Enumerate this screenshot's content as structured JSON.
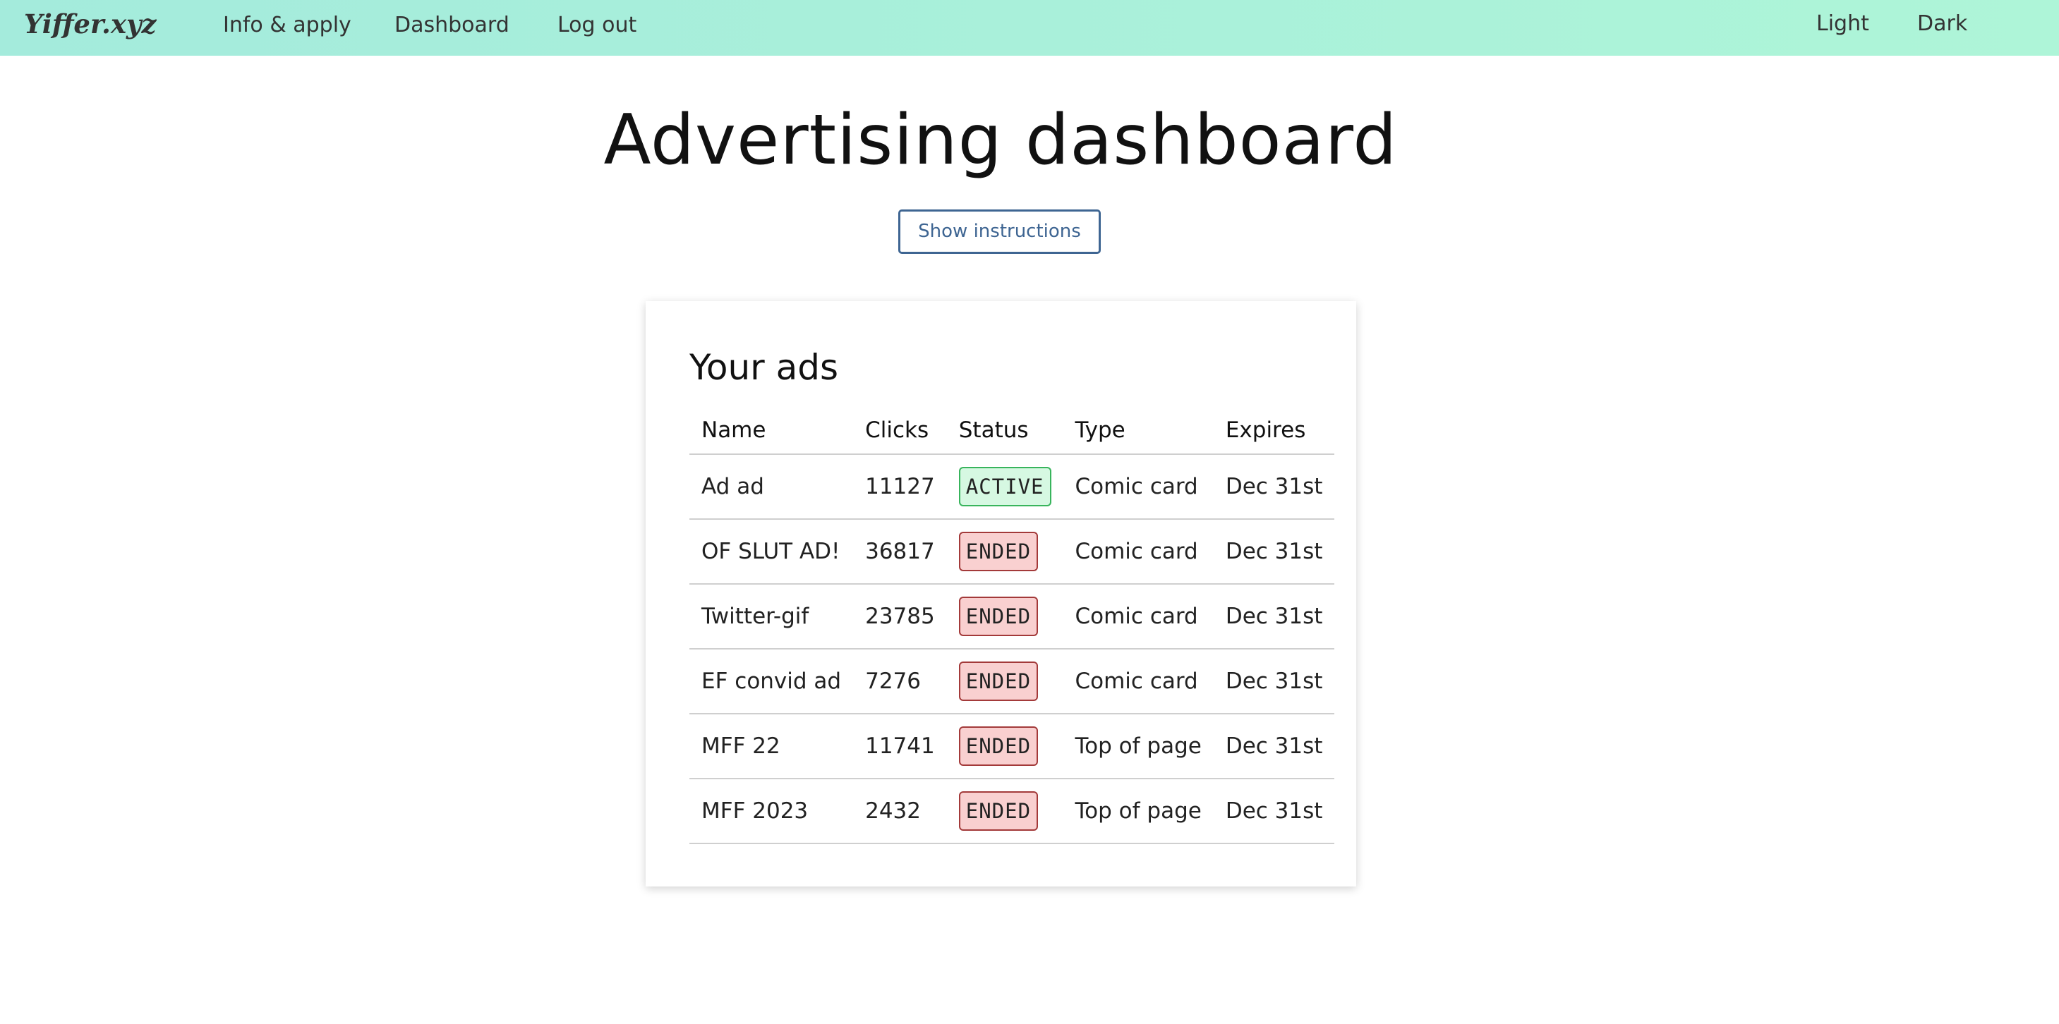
{
  "nav": {
    "brand": "Yiffer.xyz",
    "links": [
      "Info & apply",
      "Dashboard",
      "Log out"
    ],
    "theme_light": "Light",
    "theme_dark": "Dark"
  },
  "page": {
    "title": "Advertising dashboard",
    "instructions_button": "Show instructions"
  },
  "ads_card": {
    "title": "Your ads",
    "columns": [
      "Name",
      "Clicks",
      "Status",
      "Type",
      "Expires"
    ],
    "rows": [
      {
        "name": "Ad ad",
        "clicks": "11127",
        "status": "ACTIVE",
        "type": "Comic card",
        "expires": "Dec 31st"
      },
      {
        "name": "OF SLUT AD!",
        "clicks": "36817",
        "status": "ENDED",
        "type": "Comic card",
        "expires": "Dec 31st"
      },
      {
        "name": "Twitter-gif",
        "clicks": "23785",
        "status": "ENDED",
        "type": "Comic card",
        "expires": "Dec 31st"
      },
      {
        "name": "EF convid ad",
        "clicks": "7276",
        "status": "ENDED",
        "type": "Comic card",
        "expires": "Dec 31st"
      },
      {
        "name": "MFF 22",
        "clicks": "11741",
        "status": "ENDED",
        "type": "Top of page",
        "expires": "Dec 31st"
      },
      {
        "name": "MFF 2023",
        "clicks": "2432",
        "status": "ENDED",
        "type": "Top of page",
        "expires": "Dec 31st"
      }
    ]
  },
  "colors": {
    "header_gradient_start": "#a4ebdc",
    "header_gradient_end": "#aef5d8",
    "button_accent": "#3e6592",
    "status_active_bg": "#d6f8e2",
    "status_active_border": "#38b45c",
    "status_ended_bg": "#f9d0d0",
    "status_ended_border": "#a33a3a"
  }
}
